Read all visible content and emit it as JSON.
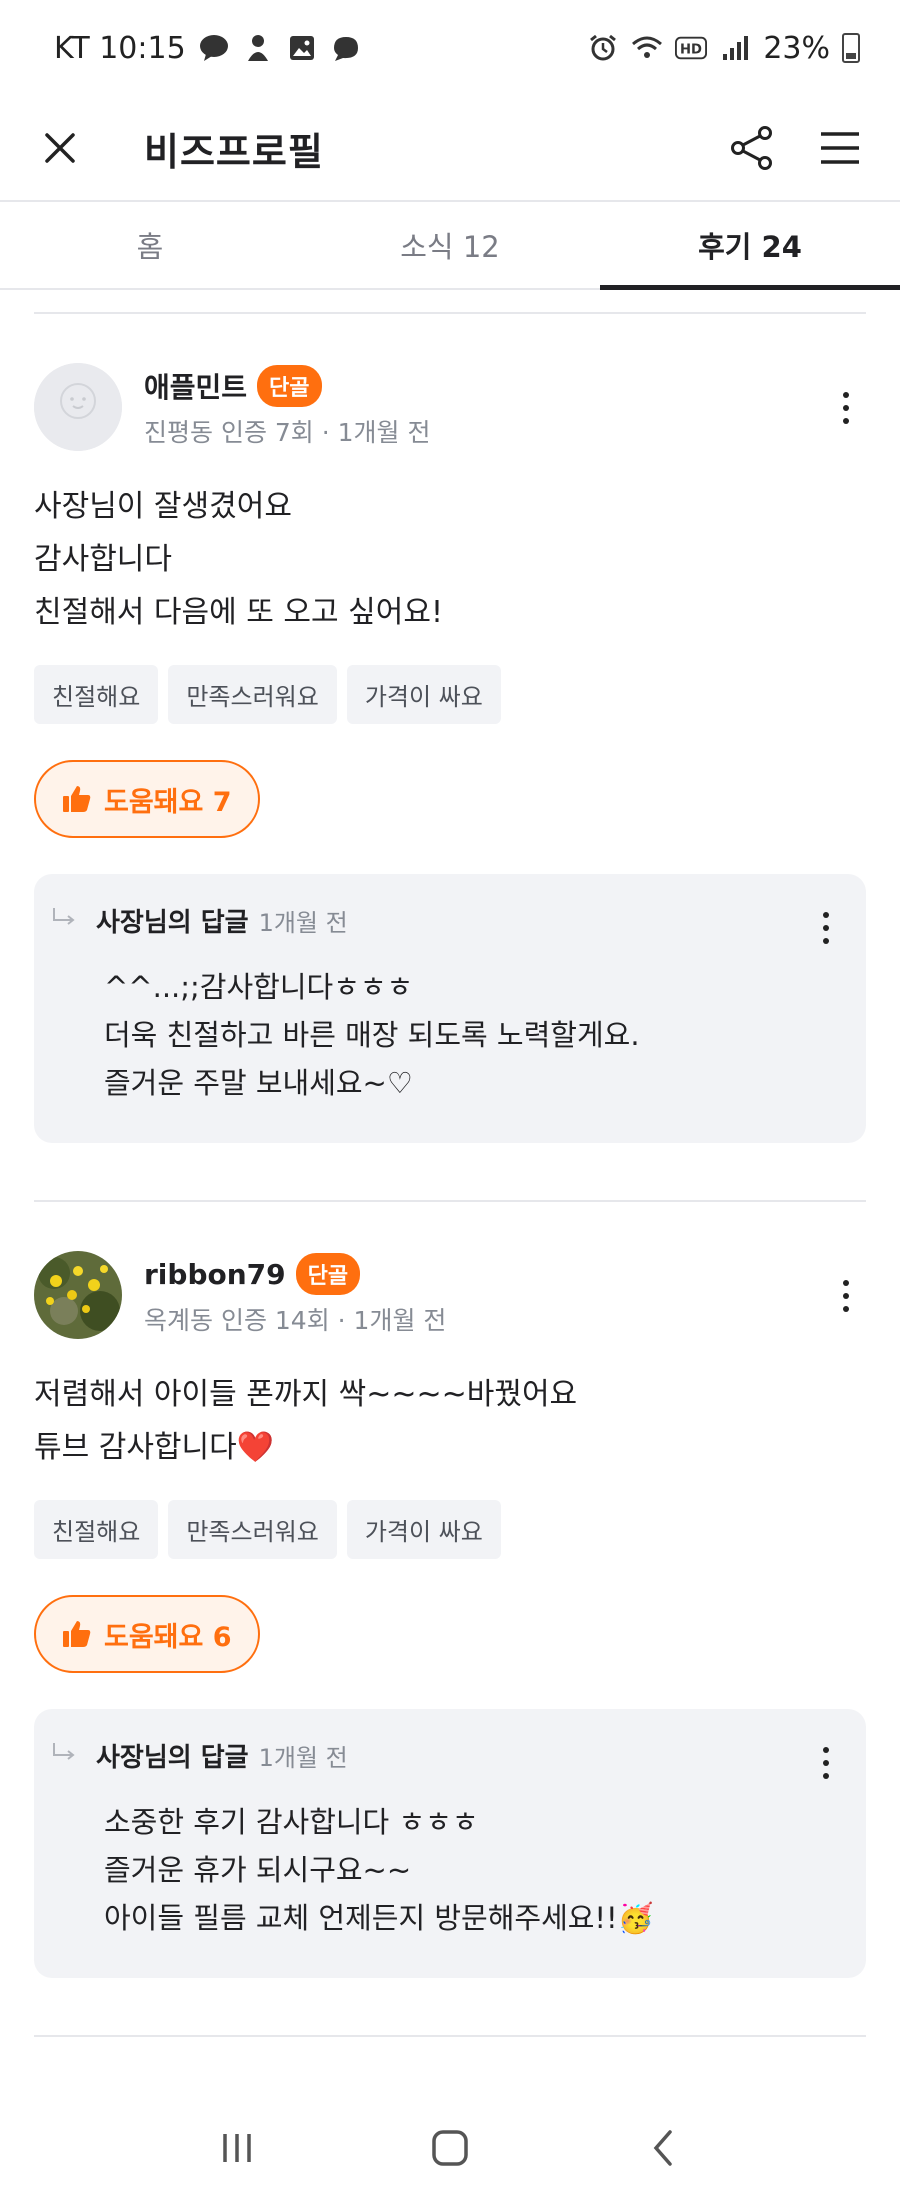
{
  "status_bar": {
    "carrier_time": "KT 10:15",
    "battery": "23%"
  },
  "app_bar": {
    "title": "비즈프로필"
  },
  "tabs": [
    {
      "label": "홈"
    },
    {
      "label": "소식 12"
    },
    {
      "label": "후기 24"
    }
  ],
  "reviews": [
    {
      "name": "애플민트",
      "badge": "단골",
      "sub": "진평동 인증 7회 · 1개월 전",
      "body": [
        "사장님이 잘생겼어요",
        "감사합니다",
        "친절해서 다음에 또 오고 싶어요!"
      ],
      "chips": [
        "친절해요",
        "만족스러워요",
        "가격이 싸요"
      ],
      "helpful": "도움돼요 7",
      "reply": {
        "title": "사장님의 답글",
        "time": "1개월 전",
        "body": [
          "^^...;;감사합니다ㅎㅎㅎ",
          "더욱 친절하고 바른 매장 되도록 노력할게요.",
          "즐거운 주말 보내세요~♡"
        ]
      }
    },
    {
      "name": "ribbon79",
      "badge": "단골",
      "sub": "옥계동 인증 14회 · 1개월 전",
      "body": [
        "저렴해서 아이들 폰까지 싹~~~~바꿨어요",
        "튜브 감사합니다❤️"
      ],
      "chips": [
        "친절해요",
        "만족스러워요",
        "가격이 싸요"
      ],
      "helpful": "도움돼요 6",
      "reply": {
        "title": "사장님의 답글",
        "time": "1개월 전",
        "body": [
          "소중한 후기 감사합니다 ㅎㅎㅎ",
          "즐거운 휴가 되시구요~~",
          "아이들 필름 교체 언제든지 방문해주세요!!🥳"
        ]
      }
    }
  ],
  "colors": {
    "accent": "#ff6f0f",
    "reply_bg": "#f2f3f6",
    "text": "#212124",
    "muted": "#868b94"
  }
}
